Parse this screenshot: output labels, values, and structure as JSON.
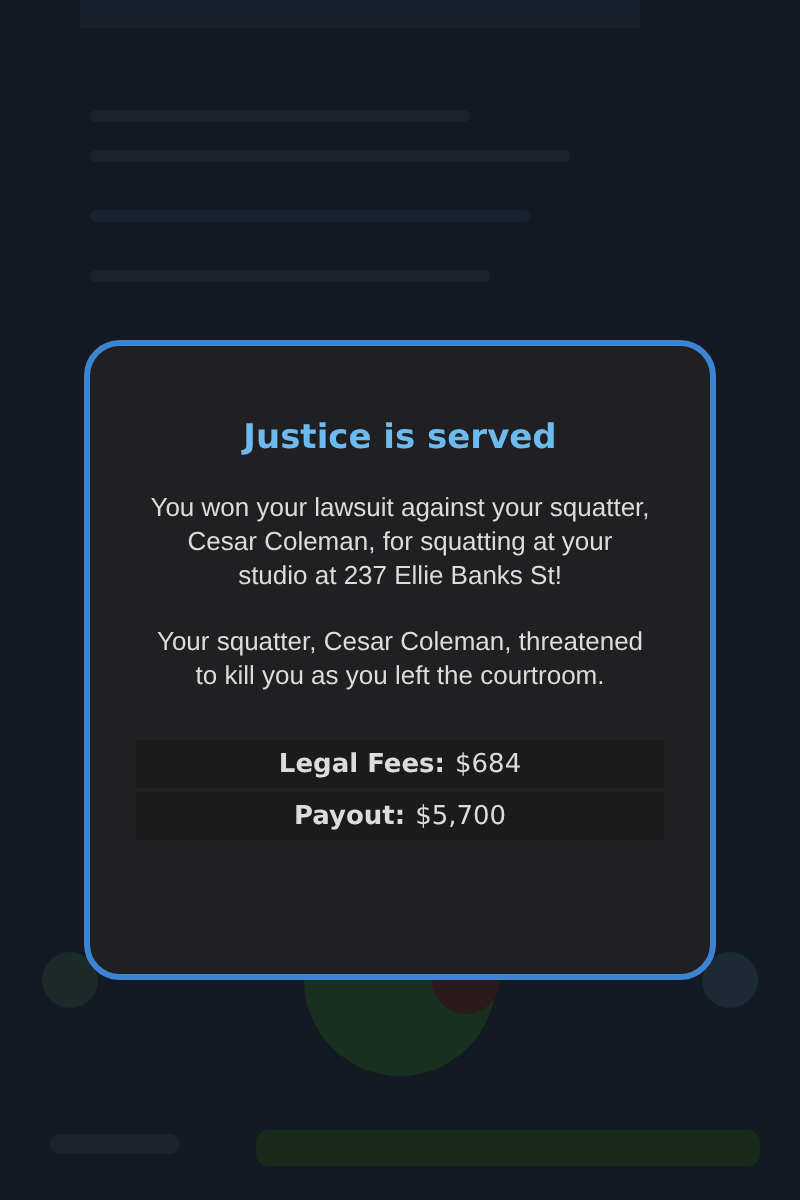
{
  "dialog": {
    "title": "Justice is served",
    "paragraphs": [
      "You won your lawsuit against your squatter, Cesar Coleman, for squatting at your studio at 237 Ellie Banks St!",
      "Your squatter, Cesar Coleman, threatened to kill you as you left the courtroom."
    ],
    "totals": [
      {
        "label": "Legal Fees:",
        "value": "$684"
      },
      {
        "label": "Payout:",
        "value": "$5,700"
      }
    ]
  }
}
